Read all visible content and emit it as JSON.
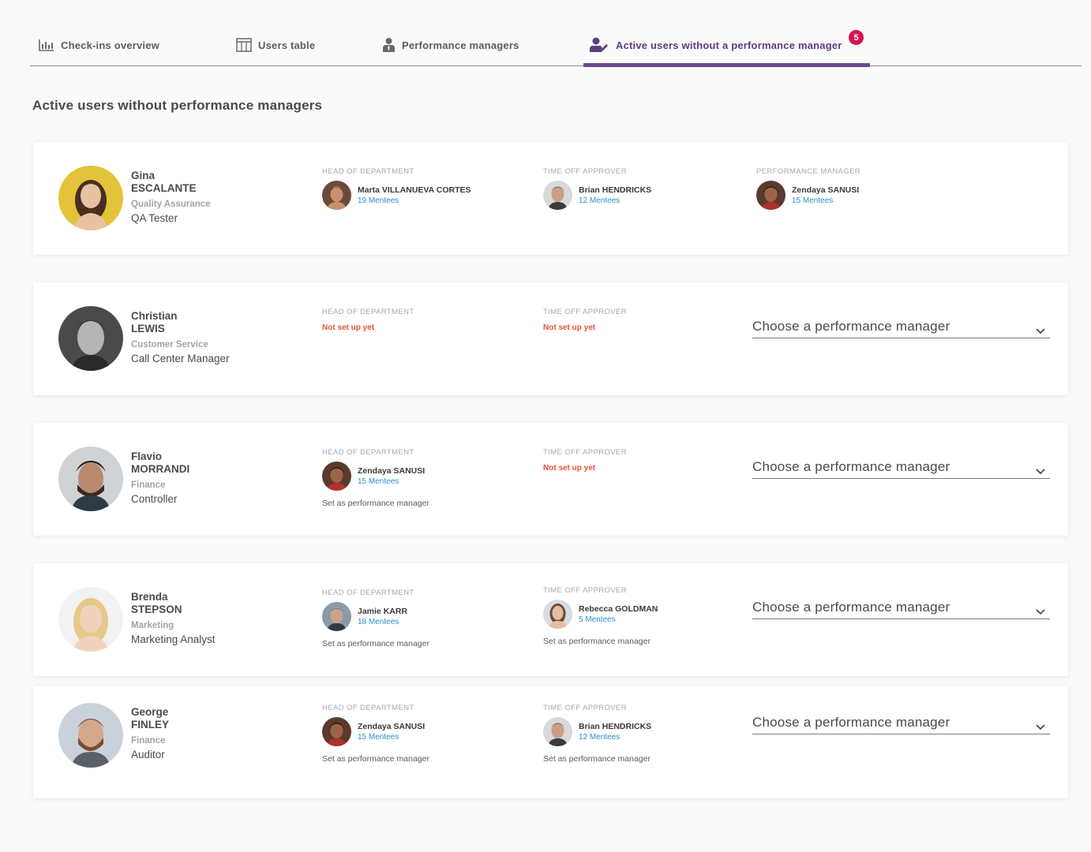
{
  "tabs": [
    {
      "label": "Check-ins overview",
      "icon": "bar-chart-icon"
    },
    {
      "label": "Users table",
      "icon": "table-icon"
    },
    {
      "label": "Performance managers",
      "icon": "person-tie-icon"
    },
    {
      "label": "Active users without a performance manager",
      "icon": "user-edit-icon",
      "badge": "5"
    }
  ],
  "page_title": "Active users without performance managers",
  "labels": {
    "head_of_department": "HEAD OF DEPARTMENT",
    "time_off_approver": "TIME OFF APPROVER",
    "performance_manager": "PERFORMANCE MANAGER",
    "not_set_up_yet": "Not set up yet",
    "set_as_pm": "Set as performance manager",
    "choose_pm": "Choose a performance manager"
  },
  "users": [
    {
      "first": "Gina",
      "last": "ESCALANTE",
      "department": "Quality Assurance",
      "job": "QA Tester",
      "hod": {
        "name": "Marta VILLANUEVA CORTES",
        "mentees": "19 Mentees"
      },
      "approver": {
        "name": "Brian HENDRICKS",
        "mentees": "12 Mentees"
      },
      "pm": {
        "name": "Zendaya SANUSI",
        "mentees": "15 Mentees"
      }
    },
    {
      "first": "Christian",
      "last": "LEWIS",
      "department": "Customer Service",
      "job": "Call Center Manager"
    },
    {
      "first": "Flavio",
      "last": "MORRANDI",
      "department": "Finance",
      "job": "Controller",
      "hod": {
        "name": "Zendaya SANUSI",
        "mentees": "15 Mentees"
      }
    },
    {
      "first": "Brenda",
      "last": "STEPSON",
      "department": "Marketing",
      "job": "Marketing Analyst",
      "hod": {
        "name": "Jamie KARR",
        "mentees": "18 Mentees"
      },
      "approver": {
        "name": "Rebecca GOLDMAN",
        "mentees": "5 Mentees"
      }
    },
    {
      "first": "George",
      "last": "FINLEY",
      "department": "Finance",
      "job": "Auditor",
      "hod": {
        "name": "Zendaya SANUSI",
        "mentees": "15 Mentees"
      },
      "approver": {
        "name": "Brian HENDRICKS",
        "mentees": "12 Mentees"
      }
    }
  ],
  "colors": {
    "accent": "#6b4a8a",
    "badge": "#d5124f",
    "warning": "#e0553a",
    "link": "#2f8fc7"
  }
}
